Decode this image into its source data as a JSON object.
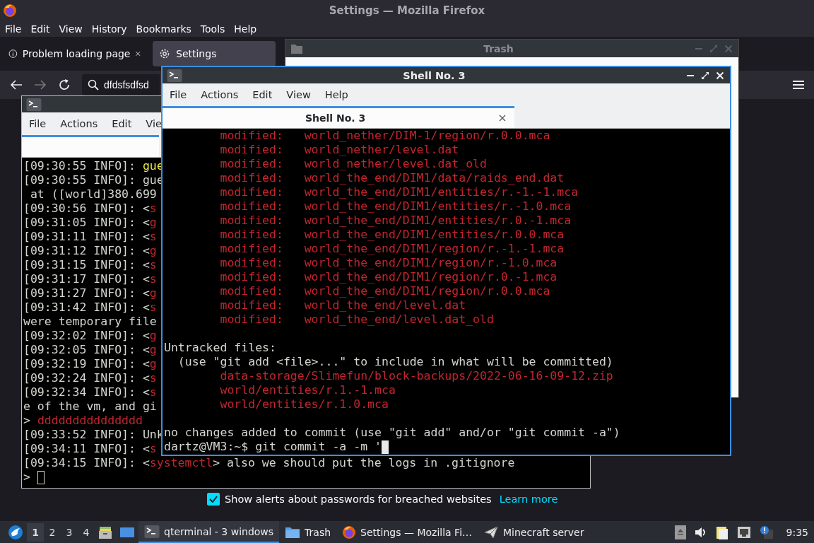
{
  "firefox": {
    "title": "Settings — Mozilla Firefox",
    "menu": [
      "File",
      "Edit",
      "View",
      "History",
      "Bookmarks",
      "Tools",
      "Help"
    ],
    "tabs": [
      {
        "label": "Problem loading page",
        "selected": false
      },
      {
        "label": "Settings",
        "selected": true
      }
    ],
    "url": "dfdsfsdfsd",
    "password_alert": {
      "label": "Show alerts about passwords for breached websites",
      "checked": true,
      "link": "Learn more"
    }
  },
  "trash_window": {
    "title": "Trash"
  },
  "server_terminal": {
    "menu": [
      "File",
      "Actions",
      "Edit",
      "Vie"
    ],
    "lines": [
      {
        "kind": "text",
        "parts": [
          {
            "text": "[09:30:55 INFO]: "
          },
          {
            "text": "gue",
            "color": "#e8e84a"
          }
        ]
      },
      {
        "kind": "text",
        "parts": [
          {
            "text": "[09:30:55 INFO]: gue"
          }
        ]
      },
      {
        "kind": "text",
        "parts": [
          {
            "text": " at ([world]380.699"
          }
        ]
      },
      {
        "kind": "text",
        "parts": [
          {
            "text": "[09:30:56 INFO]: <"
          },
          {
            "text": "s",
            "color": "#c4262e"
          }
        ]
      },
      {
        "kind": "text",
        "parts": [
          {
            "text": "[09:31:05 INFO]: <"
          },
          {
            "text": "g",
            "color": "#c4262e"
          }
        ]
      },
      {
        "kind": "text",
        "parts": [
          {
            "text": "[09:31:11 INFO]: <"
          },
          {
            "text": "s",
            "color": "#c4262e"
          }
        ]
      },
      {
        "kind": "text",
        "parts": [
          {
            "text": "[09:31:12 INFO]: <"
          },
          {
            "text": "g",
            "color": "#c4262e"
          }
        ]
      },
      {
        "kind": "text",
        "parts": [
          {
            "text": "[09:31:15 INFO]: <"
          },
          {
            "text": "s",
            "color": "#c4262e"
          }
        ]
      },
      {
        "kind": "text",
        "parts": [
          {
            "text": "[09:31:17 INFO]: <"
          },
          {
            "text": "s",
            "color": "#c4262e"
          }
        ]
      },
      {
        "kind": "text",
        "parts": [
          {
            "text": "[09:31:27 INFO]: <"
          },
          {
            "text": "g",
            "color": "#c4262e"
          }
        ]
      },
      {
        "kind": "text",
        "parts": [
          {
            "text": "[09:31:42 INFO]: <"
          },
          {
            "text": "s",
            "color": "#c4262e"
          }
        ]
      },
      {
        "kind": "text",
        "parts": [
          {
            "text": "were temporary file"
          }
        ]
      },
      {
        "kind": "text",
        "parts": [
          {
            "text": "[09:32:02 INFO]: <"
          },
          {
            "text": "g",
            "color": "#c4262e"
          }
        ]
      },
      {
        "kind": "text",
        "parts": [
          {
            "text": "[09:32:05 INFO]: <"
          },
          {
            "text": "g",
            "color": "#c4262e"
          }
        ]
      },
      {
        "kind": "text",
        "parts": [
          {
            "text": "[09:32:19 INFO]: <"
          },
          {
            "text": "g",
            "color": "#c4262e"
          }
        ]
      },
      {
        "kind": "text",
        "parts": [
          {
            "text": "[09:32:24 INFO]: <"
          },
          {
            "text": "s",
            "color": "#c4262e"
          }
        ]
      },
      {
        "kind": "text",
        "parts": [
          {
            "text": "[09:32:34 INFO]: <"
          },
          {
            "text": "s",
            "color": "#c4262e"
          }
        ]
      },
      {
        "kind": "text",
        "parts": [
          {
            "text": "e of the vm, and gi"
          }
        ]
      },
      {
        "kind": "text",
        "parts": [
          {
            "text": "> "
          },
          {
            "text": "ddddddddddddddd",
            "color": "#c4262e"
          }
        ]
      },
      {
        "kind": "text",
        "parts": [
          {
            "text": "[09:33:52 INFO]: Unk"
          }
        ]
      },
      {
        "kind": "text",
        "parts": [
          {
            "text": "[09:34:11 INFO]: <"
          },
          {
            "text": "s",
            "color": "#c4262e"
          }
        ]
      },
      {
        "kind": "text",
        "parts": [
          {
            "text": "[09:34:15 INFO]: <"
          },
          {
            "text": "systemctl",
            "color": "#c4262e"
          },
          {
            "text": "> also we should put the logs in .gitignore"
          }
        ]
      },
      {
        "kind": "text",
        "parts": [
          {
            "text": "> "
          }
        ],
        "cursor": true
      }
    ]
  },
  "shell": {
    "title": "Shell No. 3",
    "menu": [
      "File",
      "Actions",
      "Edit",
      "View",
      "Help"
    ],
    "tab": "Shell No. 3",
    "lines": [
      {
        "kind": "text",
        "parts": [
          {
            "text": "        modified:   world_nether/DIM-1/region/r.0.0.mca",
            "color": "#c4262e"
          }
        ]
      },
      {
        "kind": "text",
        "parts": [
          {
            "text": "        modified:   world_nether/level.dat",
            "color": "#c4262e"
          }
        ]
      },
      {
        "kind": "text",
        "parts": [
          {
            "text": "        modified:   world_nether/level.dat_old",
            "color": "#c4262e"
          }
        ]
      },
      {
        "kind": "text",
        "parts": [
          {
            "text": "        modified:   world_the_end/DIM1/data/raids_end.dat",
            "color": "#c4262e"
          }
        ]
      },
      {
        "kind": "text",
        "parts": [
          {
            "text": "        modified:   world_the_end/DIM1/entities/r.-1.-1.mca",
            "color": "#c4262e"
          }
        ]
      },
      {
        "kind": "text",
        "parts": [
          {
            "text": "        modified:   world_the_end/DIM1/entities/r.-1.0.mca",
            "color": "#c4262e"
          }
        ]
      },
      {
        "kind": "text",
        "parts": [
          {
            "text": "        modified:   world_the_end/DIM1/entities/r.0.-1.mca",
            "color": "#c4262e"
          }
        ]
      },
      {
        "kind": "text",
        "parts": [
          {
            "text": "        modified:   world_the_end/DIM1/entities/r.0.0.mca",
            "color": "#c4262e"
          }
        ]
      },
      {
        "kind": "text",
        "parts": [
          {
            "text": "        modified:   world_the_end/DIM1/region/r.-1.-1.mca",
            "color": "#c4262e"
          }
        ]
      },
      {
        "kind": "text",
        "parts": [
          {
            "text": "        modified:   world_the_end/DIM1/region/r.-1.0.mca",
            "color": "#c4262e"
          }
        ]
      },
      {
        "kind": "text",
        "parts": [
          {
            "text": "        modified:   world_the_end/DIM1/region/r.0.-1.mca",
            "color": "#c4262e"
          }
        ]
      },
      {
        "kind": "text",
        "parts": [
          {
            "text": "        modified:   world_the_end/DIM1/region/r.0.0.mca",
            "color": "#c4262e"
          }
        ]
      },
      {
        "kind": "text",
        "parts": [
          {
            "text": "        modified:   world_the_end/level.dat",
            "color": "#c4262e"
          }
        ]
      },
      {
        "kind": "text",
        "parts": [
          {
            "text": "        modified:   world_the_end/level.dat_old",
            "color": "#c4262e"
          }
        ]
      },
      {
        "kind": "blank"
      },
      {
        "kind": "text",
        "parts": [
          {
            "text": "Untracked files:"
          }
        ]
      },
      {
        "kind": "text",
        "parts": [
          {
            "text": "  (use \"git add <file>...\" to include in what will be committed)"
          }
        ]
      },
      {
        "kind": "text",
        "parts": [
          {
            "text": "        data-storage/Slimefun/block-backups/2022-06-16-09-12.zip",
            "color": "#c4262e"
          }
        ]
      },
      {
        "kind": "text",
        "parts": [
          {
            "text": "        world/entities/r.1.-1.mca",
            "color": "#c4262e"
          }
        ]
      },
      {
        "kind": "text",
        "parts": [
          {
            "text": "        world/entities/r.1.0.mca",
            "color": "#c4262e"
          }
        ]
      },
      {
        "kind": "blank"
      },
      {
        "kind": "text",
        "parts": [
          {
            "text": "no changes added to commit (use \"git add\" and/or \"git commit -a\")"
          }
        ]
      },
      {
        "kind": "text",
        "parts": [
          {
            "text": "dartz@VM3:~$ git commit -a -m '"
          }
        ],
        "cursor": true
      }
    ]
  },
  "taskbar": {
    "desktops": [
      {
        "label": "1",
        "selected": true
      },
      {
        "label": "2",
        "selected": false
      },
      {
        "label": "3",
        "selected": false
      },
      {
        "label": "4",
        "selected": false
      }
    ],
    "tasks": [
      {
        "label": "qterminal - 3 windows",
        "kind": "terminal",
        "selected": true
      },
      {
        "label": "Trash",
        "kind": "folder",
        "selected": false
      },
      {
        "label": "Settings — Mozilla Fi…",
        "kind": "browser",
        "selected": false
      },
      {
        "label": "Minecraft server",
        "kind": "launcher",
        "selected": false
      }
    ],
    "clock": "9:35"
  }
}
